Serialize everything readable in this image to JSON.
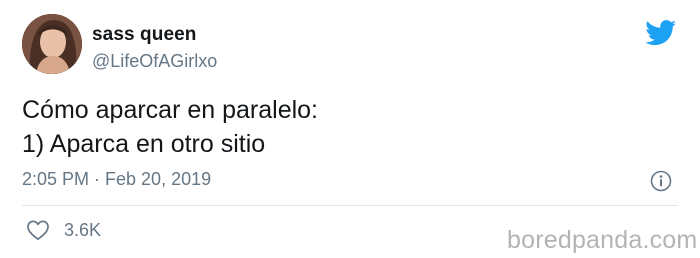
{
  "user": {
    "display_name": "sass queen",
    "handle": "@LifeOfAGirlxo",
    "avatar": "avatar-photo"
  },
  "tweet": {
    "lines": [
      "Cómo aparcar en paralelo:",
      "1) Aparca en otro sitio"
    ],
    "timestamp": "2:05 PM · Feb 20, 2019"
  },
  "actions": {
    "like_icon": "heart-icon",
    "like_count": "3.6K",
    "info_icon": "info-icon"
  },
  "branding": {
    "platform_icon": "twitter-bird-icon",
    "watermark": "boredpanda.com"
  },
  "colors": {
    "twitter_blue": "#1da1f2",
    "text_primary": "#14171a",
    "text_secondary": "#657786",
    "divider": "#e1e8ed",
    "watermark": "#b4b4b4"
  }
}
